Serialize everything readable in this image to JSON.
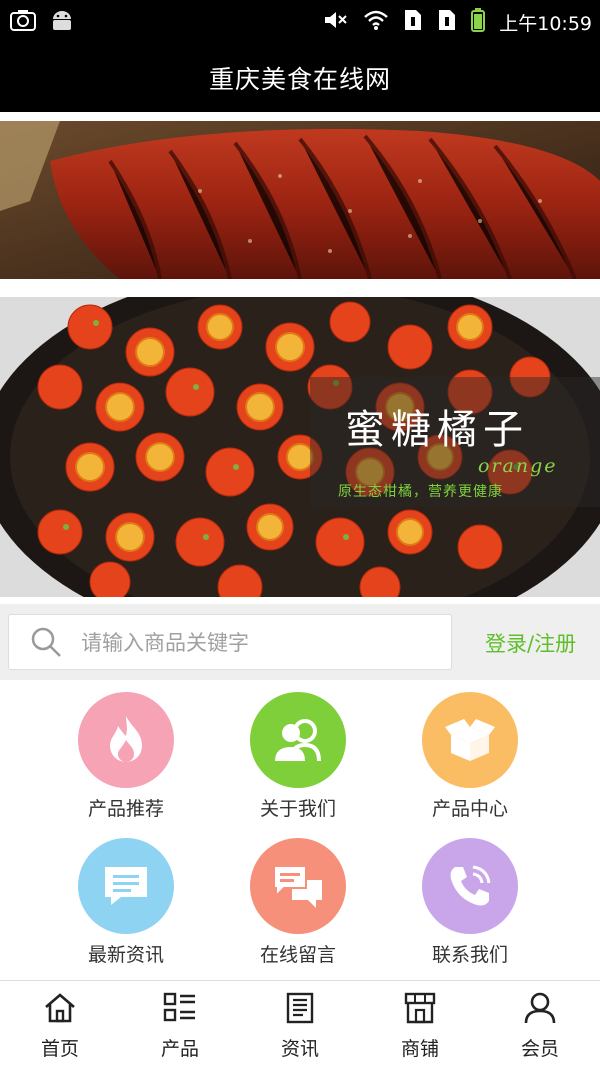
{
  "status_bar": {
    "time": "上午10:59",
    "icons": [
      "screenshot-icon",
      "android-icon",
      "mute-icon",
      "wifi-icon",
      "sim1-icon",
      "sim2-icon",
      "battery-icon"
    ]
  },
  "header": {
    "title": "重庆美食在线网"
  },
  "banner2": {
    "title": "蜜糖橘子",
    "subtitle": "orange",
    "slogan": "原生态柑橘，营养更健康"
  },
  "search": {
    "placeholder": "请输入商品关键字",
    "login_label": "登录/注册"
  },
  "nav": [
    {
      "label": "产品推荐",
      "icon": "flame-icon",
      "color": "#f5a3b5"
    },
    {
      "label": "关于我们",
      "icon": "users-icon",
      "color": "#7fcf3a"
    },
    {
      "label": "产品中心",
      "icon": "box-icon",
      "color": "#fbbd63"
    },
    {
      "label": "最新资讯",
      "icon": "message-icon",
      "color": "#8fd3f2"
    },
    {
      "label": "在线留言",
      "icon": "chat-icon",
      "color": "#f6907a"
    },
    {
      "label": "联系我们",
      "icon": "phone-icon",
      "color": "#c9a6ea"
    }
  ],
  "tabs": [
    {
      "label": "首页",
      "icon": "home-icon"
    },
    {
      "label": "产品",
      "icon": "list-icon"
    },
    {
      "label": "资讯",
      "icon": "news-icon"
    },
    {
      "label": "商铺",
      "icon": "shop-icon"
    },
    {
      "label": "会员",
      "icon": "user-icon"
    }
  ],
  "colors": {
    "accent_green": "#5fbf2a",
    "header_bg": "#000000"
  }
}
